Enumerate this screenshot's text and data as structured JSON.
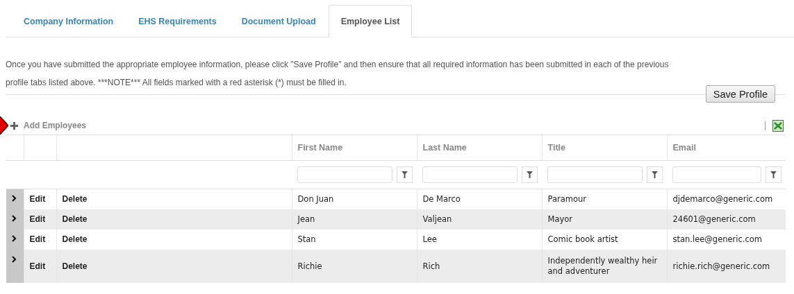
{
  "tabs": [
    {
      "label": "Company Information",
      "selected": false
    },
    {
      "label": "EHS Requirements",
      "selected": false
    },
    {
      "label": "Document Upload",
      "selected": false
    },
    {
      "label": "Employee List",
      "selected": true
    }
  ],
  "instructions": "Once you have submitted the appropriate employee information, please click \"Save Profile\" and then ensure that all required information has been submitted in each of the previous profile tabs listed above. ***NOTE*** All fields marked with a red asterisk (*) must be filled in.",
  "save_button": "Save Profile",
  "toolbar": {
    "add_label": "Add Employees"
  },
  "table": {
    "columns": [
      "First Name",
      "Last Name",
      "Title",
      "Email"
    ],
    "rows": [
      {
        "edit": "Edit",
        "delete": "Delete",
        "cells": [
          "Don Juan",
          "De Marco",
          "Paramour",
          "djdemarco@generic.com"
        ]
      },
      {
        "edit": "Edit",
        "delete": "Delete",
        "cells": [
          "Jean",
          "Valjean",
          "Mayor",
          "24601@generic.com"
        ]
      },
      {
        "edit": "Edit",
        "delete": "Delete",
        "cells": [
          "Stan",
          "Lee",
          "Comic book artist",
          "stan.lee@generic.com"
        ]
      },
      {
        "edit": "Edit",
        "delete": "Delete",
        "cells": [
          "Richie",
          "Rich",
          "Independently wealthy heir and adventurer",
          "richie.rich@generic.com"
        ]
      }
    ]
  }
}
